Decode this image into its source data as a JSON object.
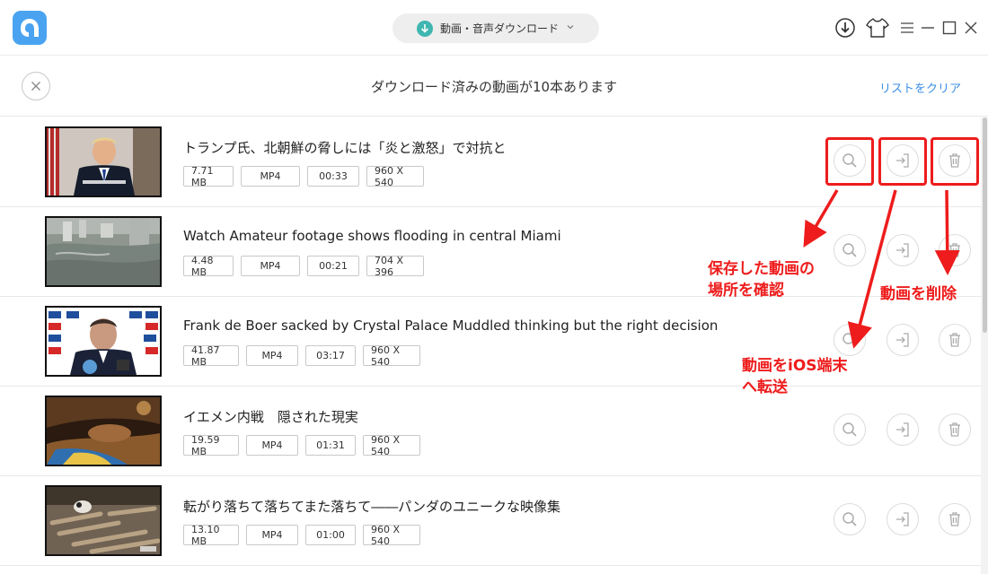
{
  "window": {
    "mode_label": "動画・音声ダウンロード",
    "icons": [
      "app-logo",
      "download-icon",
      "skin-icon",
      "menu-icon",
      "minimize-icon",
      "maximize-icon",
      "close-icon"
    ]
  },
  "header": {
    "title": "ダウンロード済みの動画が10本あります",
    "clear_label": "リストをクリア"
  },
  "videos": [
    {
      "title": "トランプ氏、北朝鮮の脅しには「炎と激怒」で対抗と",
      "size": "7.71 MB",
      "format": "MP4",
      "duration": "00:33",
      "resolution": "960 X 540"
    },
    {
      "title": "Watch Amateur footage shows flooding in central Miami",
      "size": "4.48 MB",
      "format": "MP4",
      "duration": "00:21",
      "resolution": "704 X 396"
    },
    {
      "title": "Frank de Boer sacked by Crystal Palace Muddled thinking but the right decision",
      "size": "41.87 MB",
      "format": "MP4",
      "duration": "03:17",
      "resolution": "960 X 540"
    },
    {
      "title": "イエメン内戦　隠された現実",
      "size": "19.59 MB",
      "format": "MP4",
      "duration": "01:31",
      "resolution": "960 X 540"
    },
    {
      "title": "転がり落ちて落ちてまた落ちて――パンダのユニークな映像集",
      "size": "13.10 MB",
      "format": "MP4",
      "duration": "01:00",
      "resolution": "960 X 540"
    }
  ],
  "row_actions": [
    "search-icon",
    "transfer-icon",
    "trash-icon"
  ],
  "annotations": {
    "locate_line1": "保存した動画の",
    "locate_line2": "場所を確認",
    "delete": "動画を削除",
    "transfer_line1": "動画をiOS端末",
    "transfer_line2": "へ転送"
  },
  "colors": {
    "accent": "#3a8ee6",
    "annotation": "#ee1c1c",
    "logo": "#4aa3f0",
    "mode_icon": "#3fb6b0"
  }
}
